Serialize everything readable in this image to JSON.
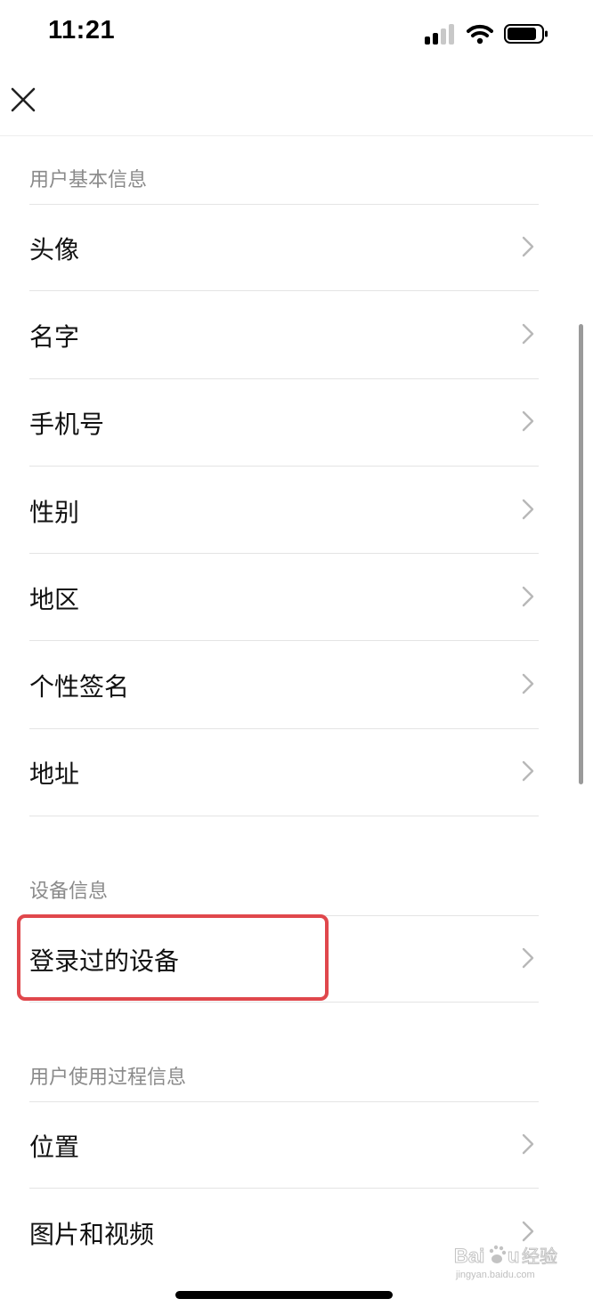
{
  "status_bar": {
    "time": "11:21"
  },
  "nav": {
    "close_icon": "close-icon"
  },
  "sections": [
    {
      "header": "用户基本信息",
      "items": [
        "头像",
        "名字",
        "手机号",
        "性别",
        "地区",
        "个性签名",
        "地址"
      ]
    },
    {
      "header": "设备信息",
      "items": [
        "登录过的设备"
      ]
    },
    {
      "header": "用户使用过程信息",
      "items": [
        "位置",
        "图片和视频"
      ]
    }
  ],
  "highlight": {
    "target": "登录过的设备",
    "color": "#e0474c"
  },
  "watermark": {
    "url": "jingyan.baidu.com"
  },
  "colors": {
    "section_header": "#8a8a8a",
    "divider": "#e4e4e4",
    "chevron": "#b8b8b8"
  }
}
